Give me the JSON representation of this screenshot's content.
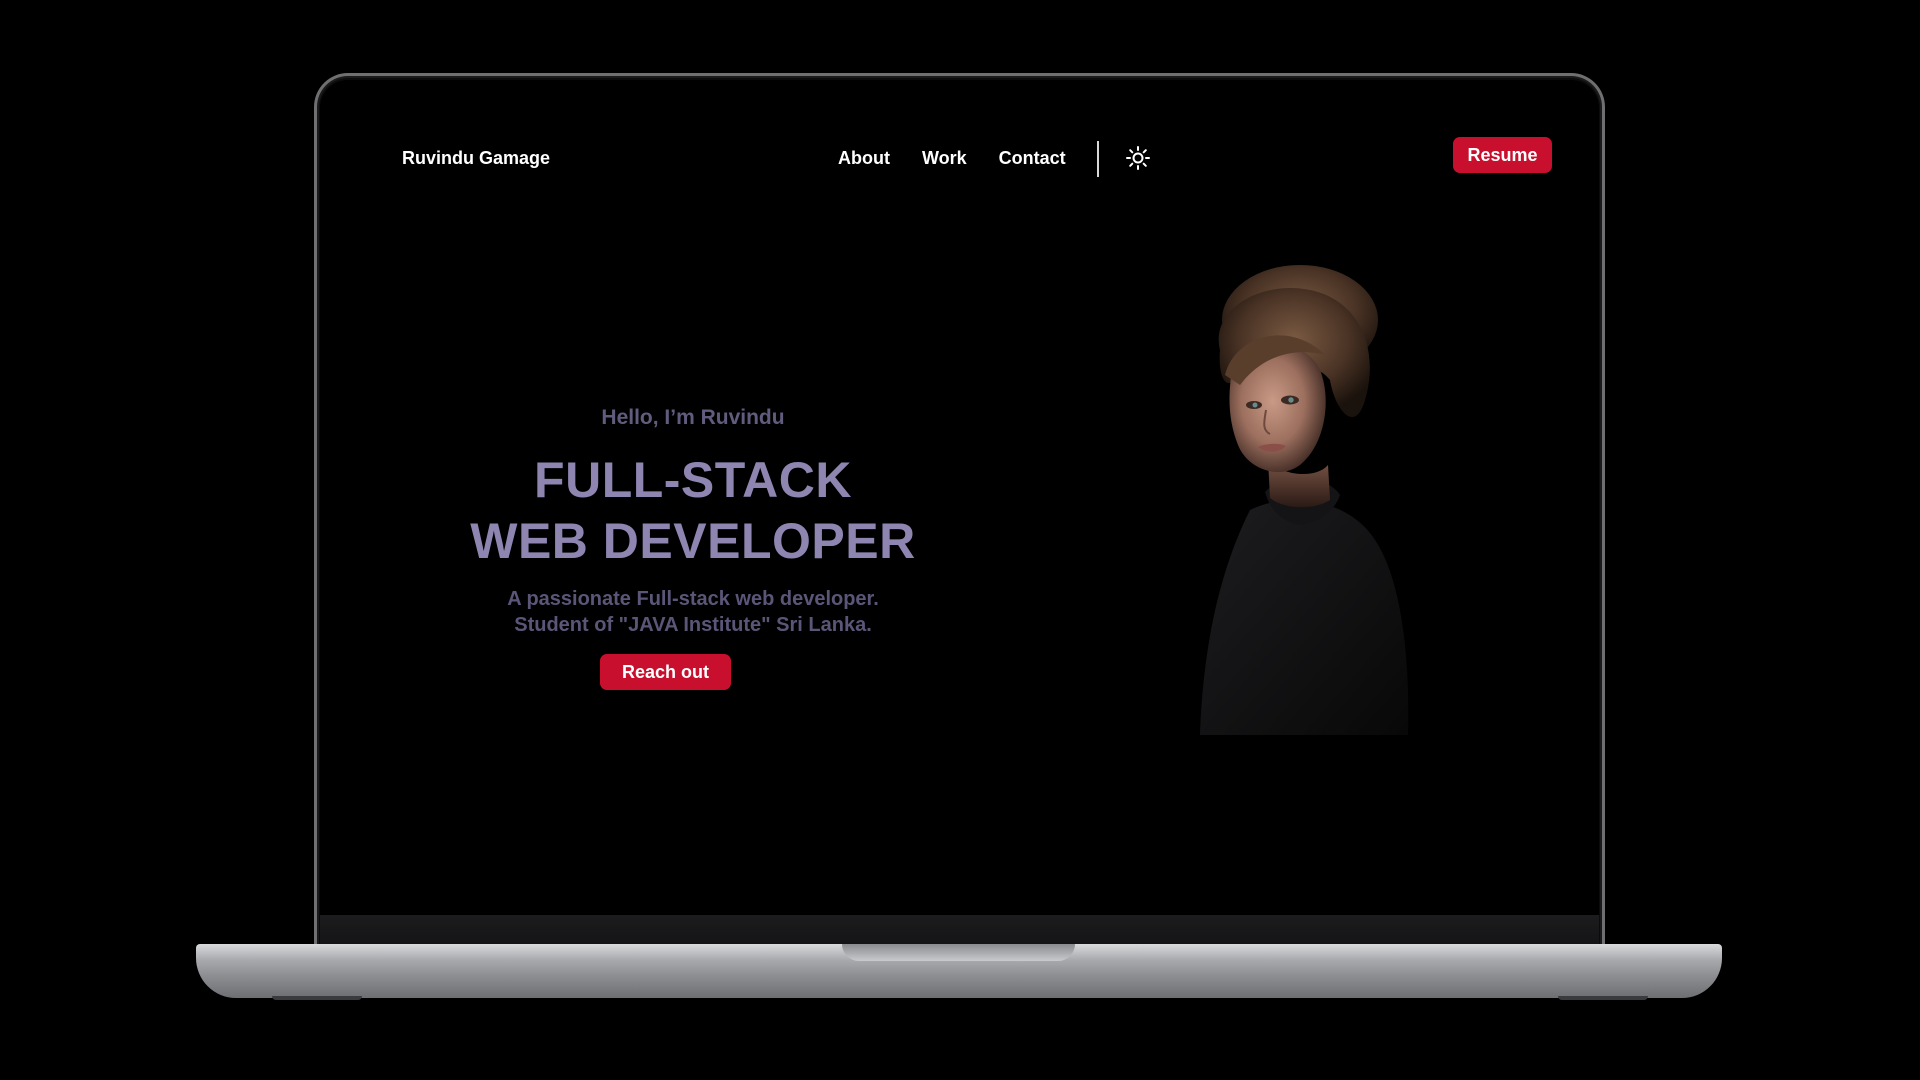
{
  "site": {
    "logo": "Ruvindu Gamage"
  },
  "nav": {
    "items": [
      {
        "label": "About"
      },
      {
        "label": "Work"
      },
      {
        "label": "Contact"
      }
    ],
    "theme_toggle_icon": "sun-icon",
    "resume_label": "Resume"
  },
  "hero": {
    "greeting": "Hello, I’m Ruvindu",
    "title_line1": "FULL-STACK",
    "title_line2": "WEB DEVELOPER",
    "subtitle_line1": "A passionate Full-stack web developer.",
    "subtitle_line2": "Student of \"JAVA Institute\" Sri Lanka.",
    "cta_label": "Reach out"
  },
  "colors": {
    "background": "#000000",
    "accent": "#c8102e",
    "title": "#8e85b1",
    "muted_text": "#615c7d"
  }
}
